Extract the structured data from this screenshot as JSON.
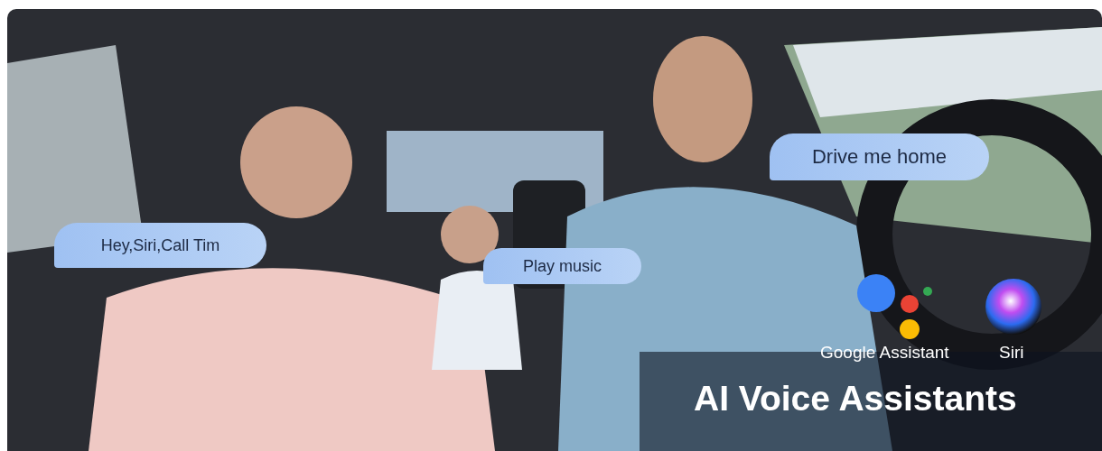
{
  "bubbles": [
    {
      "text": "Hey,Siri,Call Tim",
      "kind": "left"
    },
    {
      "text": "Play music",
      "kind": "left"
    },
    {
      "text": "Drive me home",
      "kind": "left"
    }
  ],
  "assistants": [
    {
      "name": "Google Assistant",
      "kind": "google"
    },
    {
      "name": "Siri",
      "kind": "siri"
    }
  ],
  "headline": "AI Voice Assistants"
}
